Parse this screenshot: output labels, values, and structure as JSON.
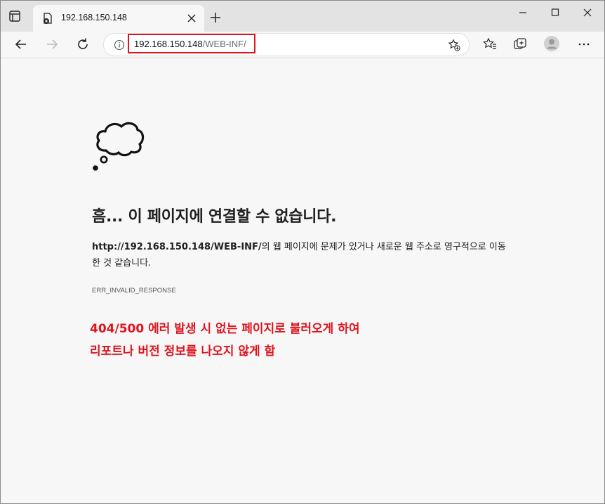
{
  "tab": {
    "title": "192.168.150.148"
  },
  "address": {
    "host": "192.168.150.148",
    "path": "/WEB-INF/"
  },
  "icons": {
    "tab_actions": "tab-actions-icon",
    "favicon": "error-page-icon",
    "close": "close-icon",
    "new_tab": "plus-icon",
    "back": "arrow-left-icon",
    "forward": "arrow-right-icon",
    "refresh": "refresh-icon",
    "info": "info-icon",
    "add_favorite": "star-plus-icon",
    "favorites": "favorites-icon",
    "collections": "collections-icon",
    "profile": "profile-icon",
    "more": "more-icon",
    "error_illustration": "thought-cloud-icon"
  },
  "error": {
    "title": "흠... 이 페이지에 연결할 수 없습니다.",
    "url": "http://192.168.150.148/WEB-INF/",
    "desc_suffix": "의 웹 페이지에 문제가 있거나 새로운 웹 주소로 영구적으로 이동한 것 같습니다.",
    "code": "ERR_INVALID_RESPONSE"
  },
  "annotation": {
    "line1": "404/500 에러 발생 시 없는 페이지로 불러오게 하여",
    "line2": "리포트나 버전 정보를 나오지 않게 함"
  },
  "colors": {
    "annotation": "#e0141e",
    "highlight_box": "#e0141e",
    "background": "#f7f7f7"
  }
}
